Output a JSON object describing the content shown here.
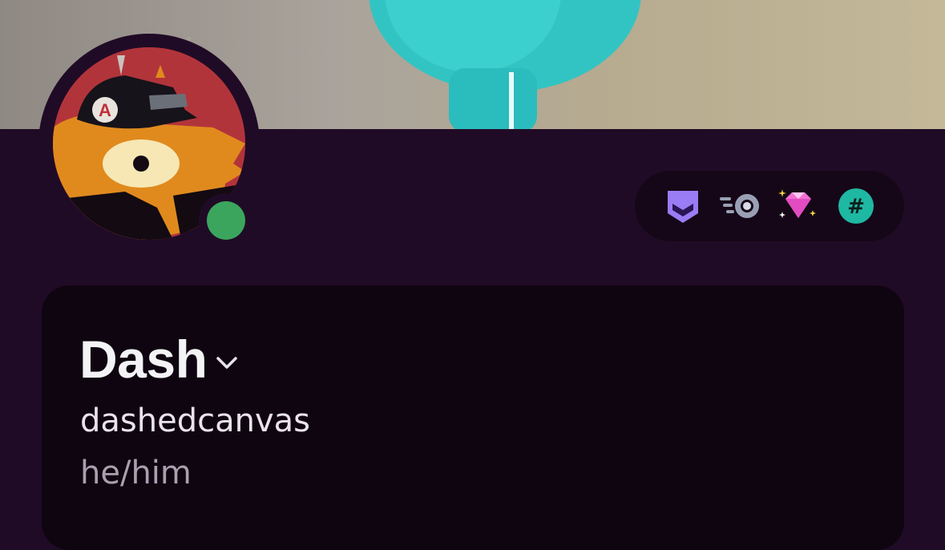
{
  "profile": {
    "display_name": "Dash",
    "username": "dashedcanvas",
    "pronouns": "he/him",
    "status": "online"
  },
  "badges": [
    {
      "icon": "hypesquad-balance-icon",
      "color": "#9a7cf4"
    },
    {
      "icon": "nitro-icon",
      "color": "#9aa0b4"
    },
    {
      "icon": "boost-gem-icon",
      "color": "#f270d2"
    },
    {
      "icon": "hashtag-icon",
      "color": "#1fb8a2"
    }
  ],
  "colors": {
    "background": "#200b26",
    "card": "#0f0510",
    "online": "#3ba55d"
  }
}
